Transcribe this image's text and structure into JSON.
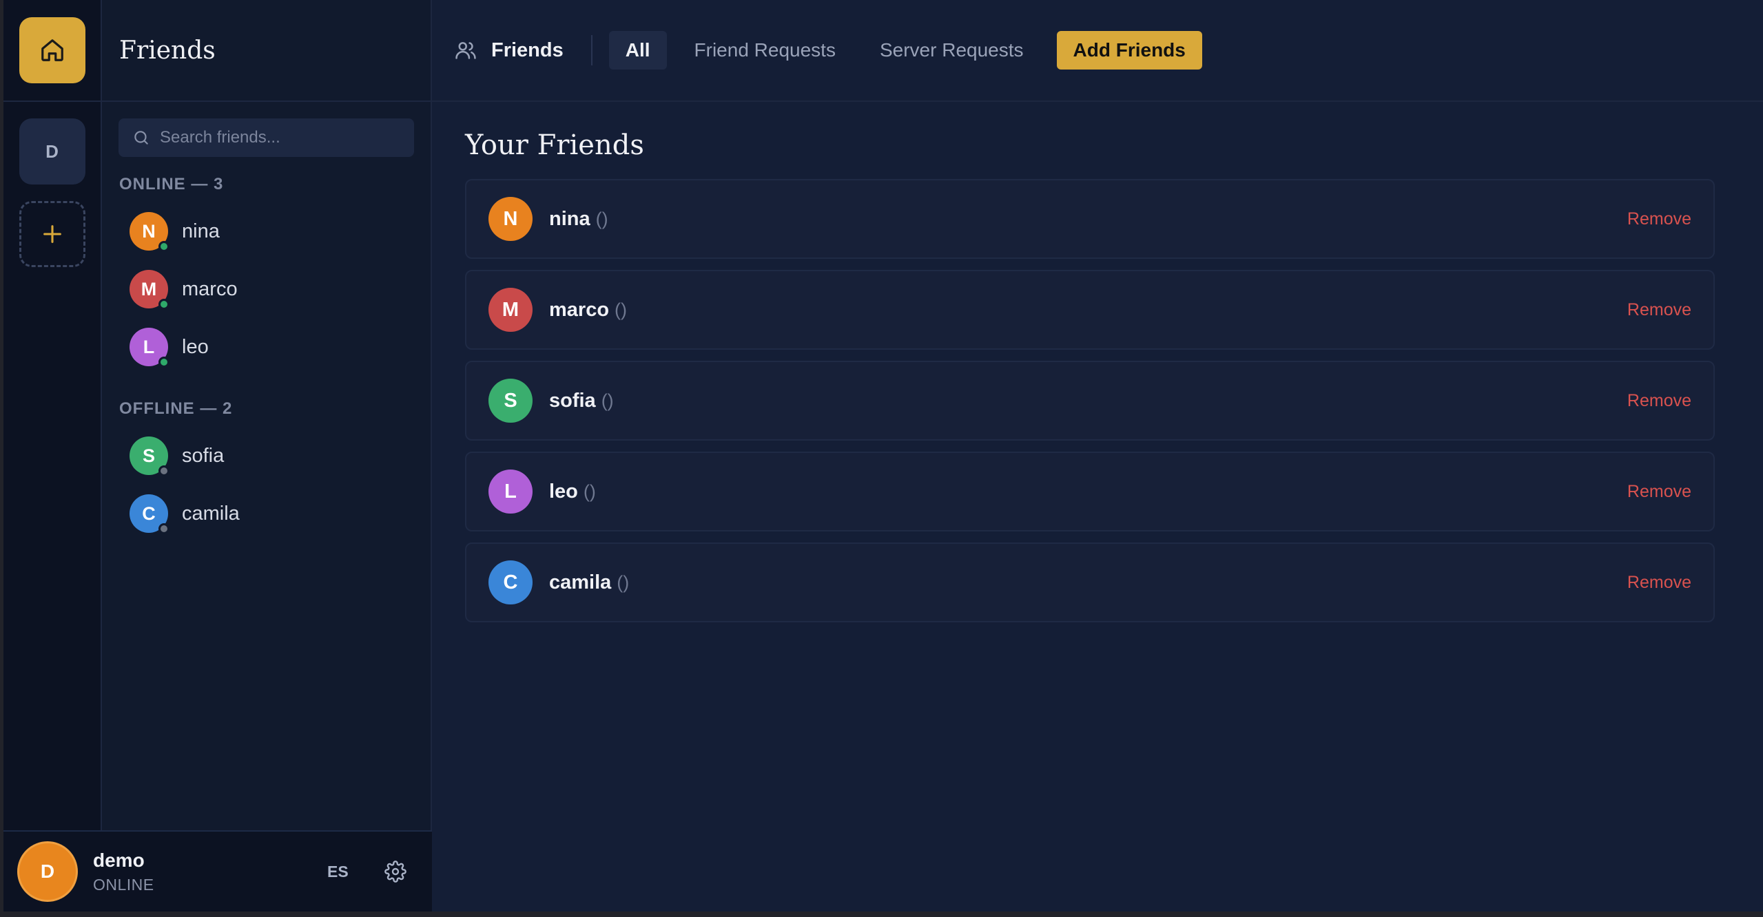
{
  "sidebar": {
    "title": "Friends",
    "search_placeholder": "Search friends...",
    "online_label": "ONLINE — 3",
    "offline_label": "OFFLINE — 2",
    "online": [
      {
        "initial": "N",
        "name": "nina",
        "color": "#e8821f"
      },
      {
        "initial": "M",
        "name": "marco",
        "color": "#c94a4a"
      },
      {
        "initial": "L",
        "name": "leo",
        "color": "#b060d8"
      }
    ],
    "offline": [
      {
        "initial": "S",
        "name": "sofia",
        "color": "#3aae6e"
      },
      {
        "initial": "C",
        "name": "camila",
        "color": "#3a86d8"
      }
    ]
  },
  "rail": {
    "server_initial": "D"
  },
  "user": {
    "initial": "D",
    "name": "demo",
    "status": "ONLINE",
    "lang": "ES"
  },
  "header": {
    "title": "Friends",
    "tabs": [
      "All",
      "Friend Requests",
      "Server Requests"
    ],
    "add_label": "Add Friends"
  },
  "main": {
    "title": "Your Friends",
    "paren": "()",
    "remove_label": "Remove",
    "friends": [
      {
        "initial": "N",
        "name": "nina",
        "color": "#e8821f"
      },
      {
        "initial": "M",
        "name": "marco",
        "color": "#c94a4a"
      },
      {
        "initial": "S",
        "name": "sofia",
        "color": "#3aae6e"
      },
      {
        "initial": "L",
        "name": "leo",
        "color": "#b060d8"
      },
      {
        "initial": "C",
        "name": "camila",
        "color": "#3a86d8"
      }
    ]
  },
  "colors": {
    "accent": "#d9a93a",
    "online_dot": "#2faa6a",
    "offline_dot": "#6b7280",
    "danger": "#d9524f"
  }
}
